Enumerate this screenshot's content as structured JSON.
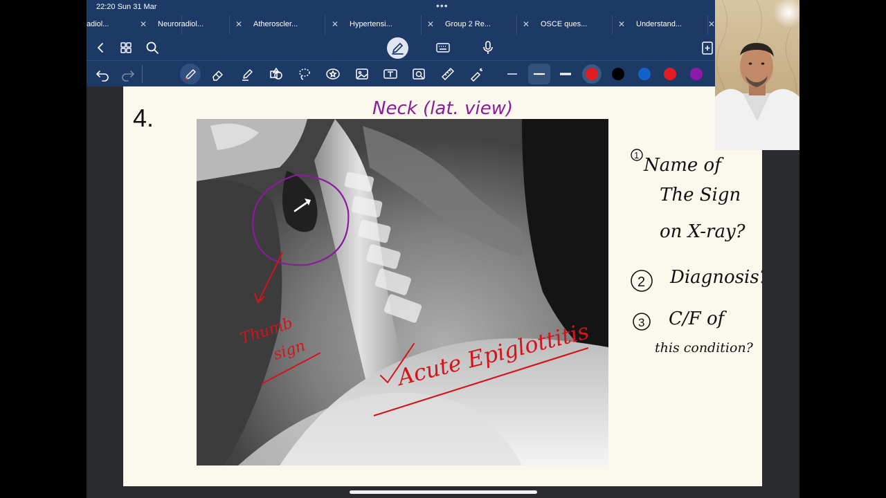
{
  "status_bar": {
    "time_date": "22:20  Sun 31 Mar",
    "dots": "•••"
  },
  "tabs": [
    {
      "label": "adiol..."
    },
    {
      "label": "Neuroradiol..."
    },
    {
      "label": "Atheroscler..."
    },
    {
      "label": "Hypertensi..."
    },
    {
      "label": "Group 2 Re..."
    },
    {
      "label": "OSCE ques..."
    },
    {
      "label": "Understand..."
    }
  ],
  "nav_icons": [
    "back-chevron-icon",
    "grid-icon",
    "search-icon",
    "pencil-mode-icon",
    "keyboard-icon",
    "microphone-icon",
    "add-page-icon"
  ],
  "toolbar": {
    "tools": [
      "undo-icon",
      "redo-icon",
      "pen-icon",
      "eraser-icon",
      "highlighter-icon",
      "shapes-icon",
      "lasso-icon",
      "sticker-icon",
      "image-icon",
      "text-box-icon",
      "camera-icon",
      "ruler-icon",
      "laser-pointer-icon"
    ],
    "thickness": [
      "thin",
      "medium",
      "thick"
    ],
    "colors": [
      "#e11d24",
      "#000000",
      "#1361c9",
      "#e11d24",
      "#8d1aa8"
    ],
    "selected_color": "#e11d24"
  },
  "page": {
    "question_number": "4.",
    "title": "Neck (lat. view)",
    "questions": [
      "Name of",
      "The Sign",
      "on X-ray?",
      "Diagnosis?",
      "C/F of",
      "this condition?"
    ],
    "question_markers": [
      "1",
      "2",
      "3"
    ],
    "annotations": {
      "sign_label_1": "Thumb",
      "sign_label_2": "sign",
      "diagnosis": "Acute Epiglottitis",
      "check_mark": "✓"
    }
  },
  "colors": {
    "app_bar": "#1d3a66",
    "page_bg": "#fbf9ee",
    "ink_purple": "#8a1c9c",
    "ink_red": "#d4141a",
    "ink_black": "#111111"
  }
}
